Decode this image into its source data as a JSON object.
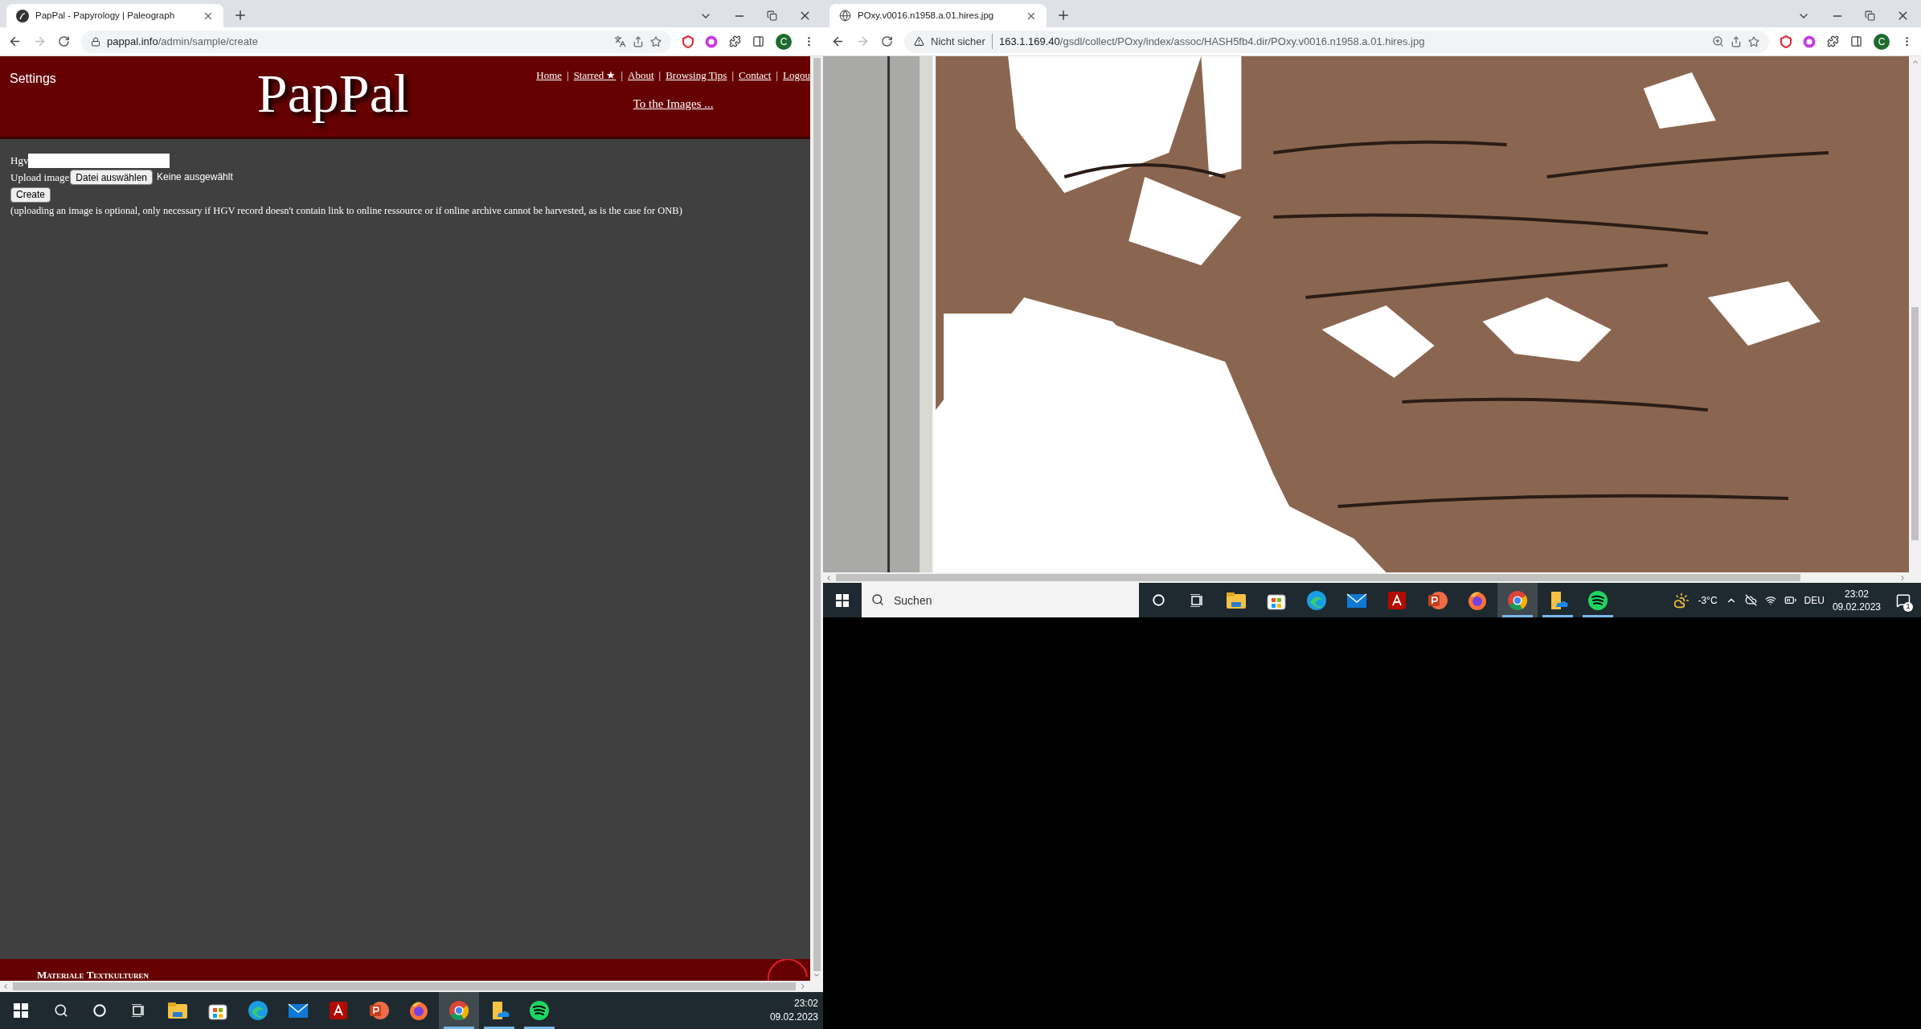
{
  "left_browser": {
    "tab_title": "PapPal - Papyrology | Paleograph",
    "url_host": "pappal.info",
    "url_path": "/admin/sample/create",
    "secure": true,
    "profile_initial": "C",
    "page": {
      "settings": "Settings",
      "logo": "PapPal",
      "nav_links": [
        "Home",
        "Starred ★",
        "About",
        "Browsing Tips",
        "Contact",
        "Logou"
      ],
      "nav_separators": [
        "|",
        "|",
        "|",
        "|",
        "|"
      ],
      "images_link": "To the Images ...",
      "form": {
        "hgv_label": "Hgv",
        "upload_label": "Upload image",
        "file_button": "Datei auswählen",
        "file_status": "Keine ausgewählt",
        "create_button": "Create",
        "note": "(uploading an image is optional, only necessary if HGV record doesn't contain link to online ressource or if online archive cannot be harvested, as is the case for ONB)"
      },
      "footer": "Materiale Textkulturen"
    }
  },
  "left_taskbar": {
    "apps": [
      {
        "kind": "explorer",
        "running": false,
        "selected": false
      },
      {
        "kind": "store",
        "running": false,
        "selected": false
      },
      {
        "kind": "edge",
        "running": false,
        "selected": false
      },
      {
        "kind": "mail",
        "running": false,
        "selected": false
      },
      {
        "kind": "acrobat",
        "running": false,
        "selected": false
      },
      {
        "kind": "powerpoint",
        "running": false,
        "selected": false
      },
      {
        "kind": "firefox",
        "running": false,
        "selected": false
      },
      {
        "kind": "chrome",
        "running": true,
        "selected": true
      },
      {
        "kind": "files",
        "running": true,
        "selected": false
      },
      {
        "kind": "spotify",
        "running": true,
        "selected": false
      }
    ],
    "time": "23:02",
    "date": "09.02.2023"
  },
  "right_browser": {
    "tab_title": "POxy.v0016.n1958.a.01.hires.jpg",
    "security": "Nicht sicher",
    "secure": false,
    "url_host": "163.1.169.40",
    "url_path": "/gsdl/collect/POxy/index/assoc/HASH5fb4.dir/POxy.v0016.n1958.a.01.hires.jpg",
    "profile_initial": "C"
  },
  "right_taskbar": {
    "search_placeholder": "Suchen",
    "apps": [
      {
        "kind": "explorer",
        "running": false,
        "selected": false
      },
      {
        "kind": "store",
        "running": false,
        "selected": false
      },
      {
        "kind": "edge",
        "running": false,
        "selected": false
      },
      {
        "kind": "mail",
        "running": false,
        "selected": false
      },
      {
        "kind": "acrobat",
        "running": false,
        "selected": false
      },
      {
        "kind": "powerpoint",
        "running": false,
        "selected": false
      },
      {
        "kind": "firefox",
        "running": false,
        "selected": false
      },
      {
        "kind": "chrome",
        "running": true,
        "selected": true
      },
      {
        "kind": "files",
        "running": true,
        "selected": false
      },
      {
        "kind": "spotify",
        "running": true,
        "selected": false
      }
    ],
    "weather": "-3°C",
    "language": "DEU",
    "time": "23:02",
    "date": "09.02.2023",
    "notification_count": "1"
  }
}
